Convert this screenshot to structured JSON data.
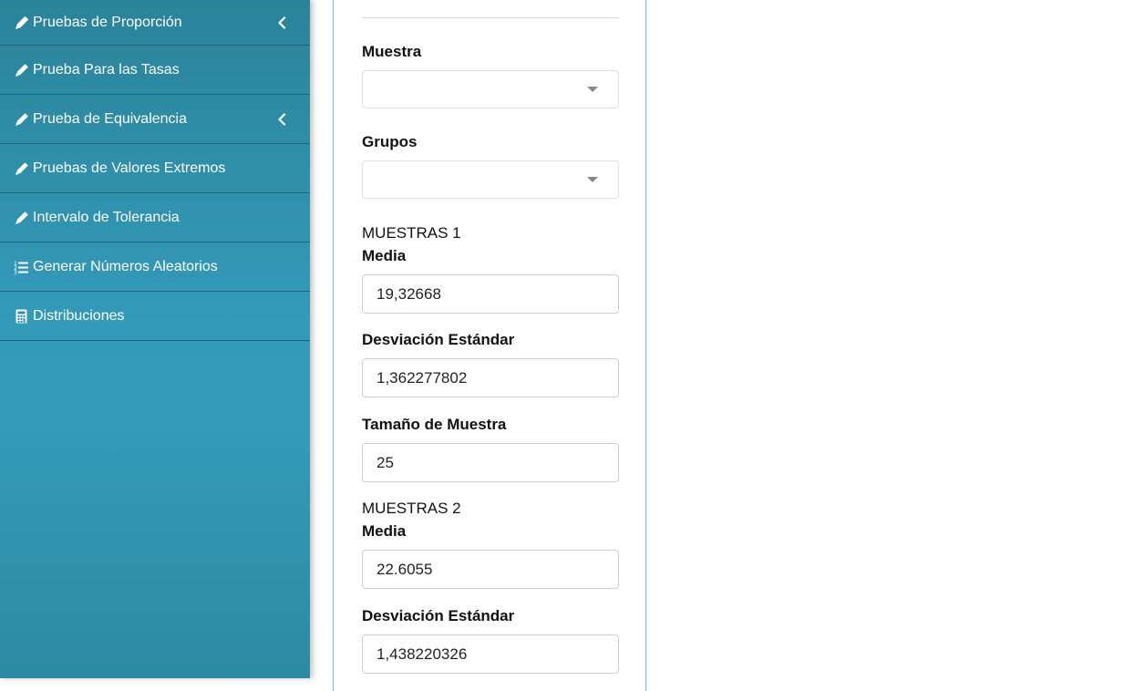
{
  "sidebar": {
    "items": [
      {
        "label": "Pruebas de Proporción",
        "icon": "pencil-icon",
        "has_chevron": true
      },
      {
        "label": "Prueba Para las Tasas",
        "icon": "pencil-icon",
        "has_chevron": false
      },
      {
        "label": "Prueba de Equivalencia",
        "icon": "pencil-icon",
        "has_chevron": true
      },
      {
        "label": "Pruebas de Valores Extremos",
        "icon": "pencil-icon",
        "has_chevron": false
      },
      {
        "label": "Intervalo de Tolerancia",
        "icon": "pencil-icon",
        "has_chevron": false
      },
      {
        "label": "Generar Números Aleatorios",
        "icon": "list-ol-icon",
        "has_chevron": false
      },
      {
        "label": "Distribuciones",
        "icon": "calculator-icon",
        "has_chevron": false
      }
    ]
  },
  "form": {
    "muestra_label": "Muestra",
    "muestra_value": "",
    "grupos_label": "Grupos",
    "grupos_value": "",
    "sample1": {
      "heading": "MUESTRAS 1",
      "media_label": "Media",
      "media_value": "19,32668",
      "desv_label": "Desviación Estándar",
      "desv_value": "1,362277802",
      "tam_label": "Tamaño de Muestra",
      "tam_value": "25"
    },
    "sample2": {
      "heading": "MUESTRAS 2",
      "media_label": "Media",
      "media_value": "22.6055",
      "desv_label": "Desviación Estándar",
      "desv_value": "1,438220326"
    }
  },
  "colors": {
    "sidebar_top": "#2a8399",
    "sidebar_mid": "#349cba",
    "card_border": "#5fd4c0"
  }
}
